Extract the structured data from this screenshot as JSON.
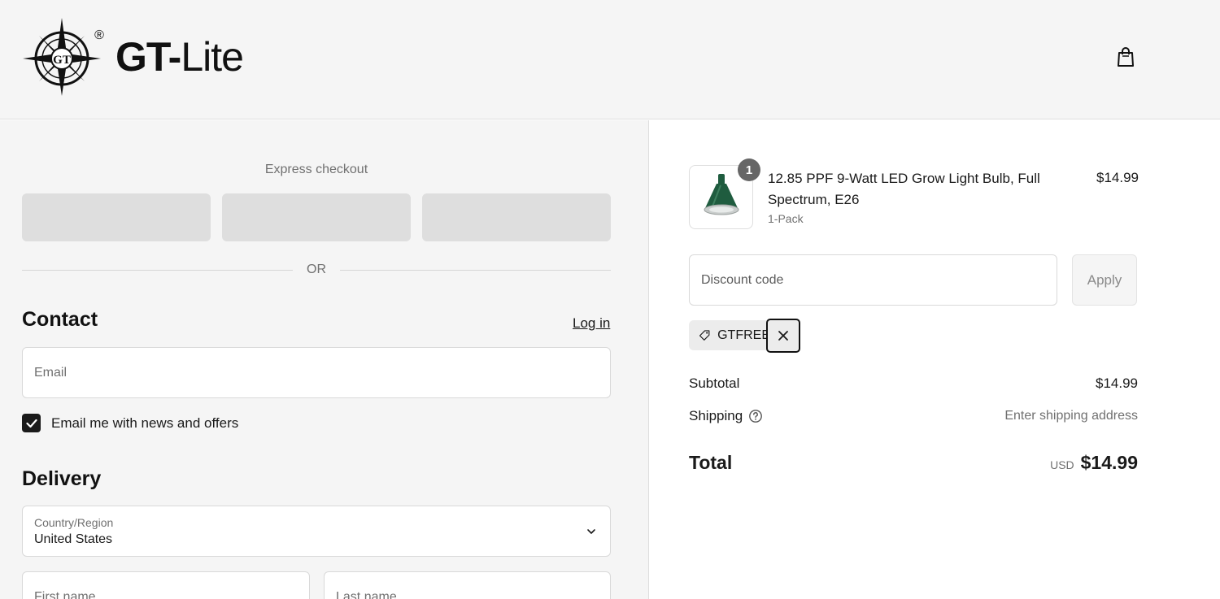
{
  "header": {
    "brand": {
      "bold": "GT-",
      "light": "Lite",
      "registered": "®",
      "mark_letters": "GT"
    },
    "cart_icon": "shopping-bag-icon"
  },
  "express": {
    "title": "Express checkout",
    "divider": "OR"
  },
  "contact": {
    "title": "Contact",
    "login_label": "Log in",
    "email_placeholder": "Email",
    "newsletter_label": "Email me with news and offers",
    "newsletter_checked": true
  },
  "delivery": {
    "title": "Delivery",
    "country_label": "Country/Region",
    "country_value": "United States",
    "first_name_placeholder": "First name",
    "last_name_placeholder": "Last name"
  },
  "order": {
    "item": {
      "quantity": "1",
      "name": "12.85 PPF 9-Watt LED Grow Light Bulb, Full Spectrum, E26",
      "variant": "1-Pack",
      "price": "$14.99"
    },
    "discount": {
      "placeholder": "Discount code",
      "apply_label": "Apply",
      "applied_code": "GTFREE"
    },
    "subtotal_label": "Subtotal",
    "subtotal_value": "$14.99",
    "shipping_label": "Shipping",
    "shipping_value": "Enter shipping address",
    "total_label": "Total",
    "total_currency": "USD",
    "total_value": "$14.99"
  },
  "colors": {
    "left_bg": "#f5f5f5",
    "text": "#1a1a1a",
    "muted": "#707070",
    "bulb_green": "#1f5c3f"
  }
}
